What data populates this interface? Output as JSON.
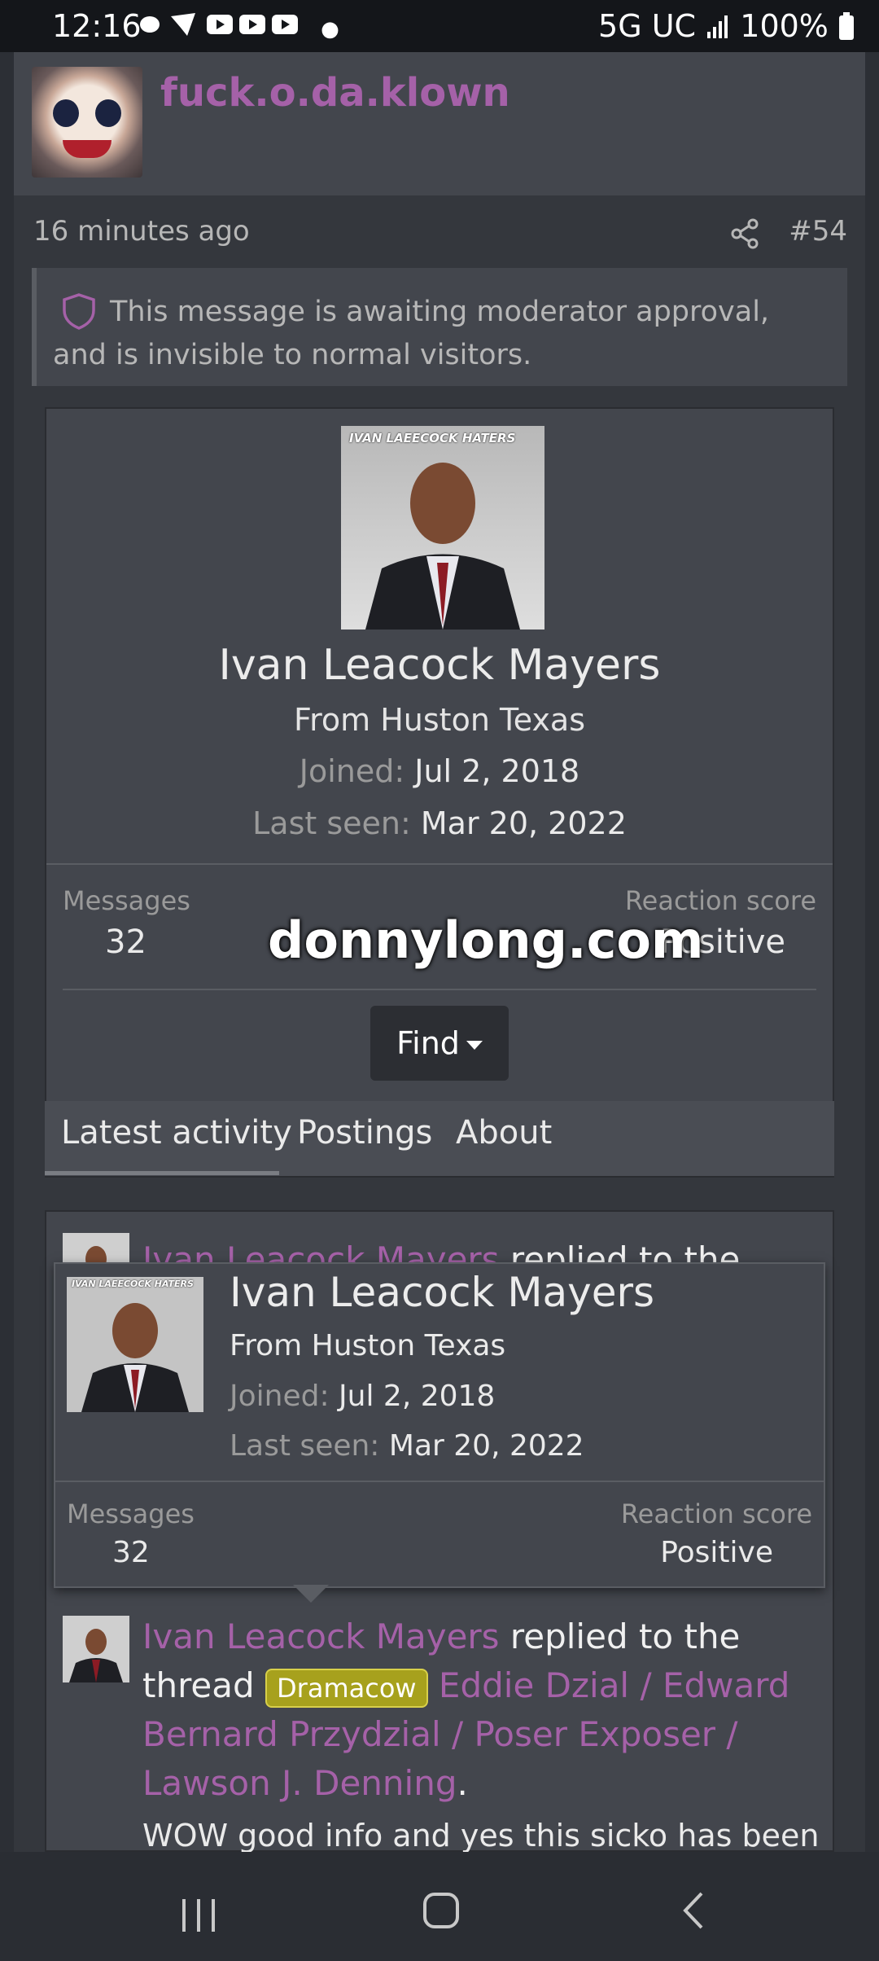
{
  "status_bar": {
    "time": "12:16",
    "network": "5G UC",
    "battery": "100%"
  },
  "post": {
    "author": "fuck.o.da.klown",
    "time_ago": "16 minutes ago",
    "post_number": "#54",
    "moderation_notice": "This message is awaiting moderator approval, and is invisible to normal visitors."
  },
  "profile": {
    "photo_caption": "IVAN LAEECOCK HATERS",
    "name": "Ivan Leacock Mayers",
    "location": "From Huston Texas",
    "joined_label": "Joined:",
    "joined_value": "Jul 2, 2018",
    "last_seen_label": "Last seen:",
    "last_seen_value": "Mar 20, 2022",
    "messages_label": "Messages",
    "messages_value": "32",
    "reaction_label": "Reaction score",
    "reaction_value": "Positive",
    "watermark": "donnylong.com",
    "find_label": "Find"
  },
  "tabs": [
    {
      "label": "Latest activity"
    },
    {
      "label": "Postings"
    },
    {
      "label": "About"
    }
  ],
  "activity": {
    "hidden_author": "Ivan Leacock Mayers",
    "hidden_text": "replied to the",
    "author": "Ivan Leacock Mayers",
    "verb": "replied to the",
    "word_thread": "thread",
    "tag": "Dramacow",
    "thread_title_line1": "Eddie Dzial / Edward",
    "thread_title_line2": "Bernard Przydzial / Poser Exposer /",
    "thread_title_line3": "Lawson J. Denning",
    "snippet": "WOW good info and yes this sicko has been"
  },
  "colors": {
    "accent_link": "#a561a8",
    "tag_background": "#a7a11d",
    "page_background": "#34373d"
  }
}
